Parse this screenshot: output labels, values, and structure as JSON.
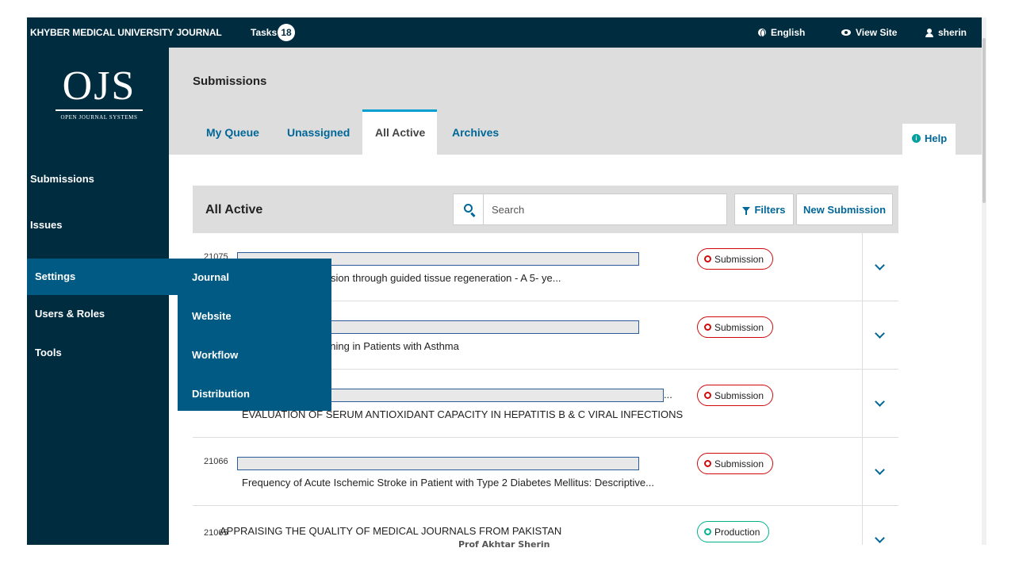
{
  "topbar": {
    "site_name": "KHYBER MEDICAL UNIVERSITY JOURNAL",
    "tasks_label": "Tasks",
    "tasks_count": "18",
    "language": "English",
    "view_site": "View Site",
    "user": "sherin"
  },
  "logo": {
    "text": "OJS",
    "subtitle": "OPEN JOURNAL SYSTEMS"
  },
  "sidebar": {
    "items": [
      {
        "label": "Submissions"
      },
      {
        "label": "Issues"
      },
      {
        "label": "Settings"
      },
      {
        "label": "Users & Roles"
      },
      {
        "label": "Tools"
      }
    ],
    "settings_flyout": [
      "Journal",
      "Website",
      "Workflow",
      "Distribution"
    ]
  },
  "header": {
    "title": "Submissions",
    "tabs": [
      "My Queue",
      "Unassigned",
      "All Active",
      "Archives"
    ],
    "active_tab": "All Active",
    "help": "Help"
  },
  "panel": {
    "title": "All Active",
    "search_placeholder": "Search",
    "filters_label": "Filters",
    "new_submission_label": "New Submission"
  },
  "submissions": [
    {
      "id": "21075",
      "title": "ent of endo-perio lesion through guided tissue regeneration - A 5- ye...",
      "status": "Submission"
    },
    {
      "id": "",
      "title": "d Cognitive Functioning in Patients with Asthma",
      "status": "Submission"
    },
    {
      "id": "",
      "title": "EVALUATION OF SERUM ANTIOXIDANT CAPACITY IN HEPATITIS B & C VIRAL INFECTIONS",
      "status": "Submission",
      "ellipsis": "..."
    },
    {
      "id": "21066",
      "title": "Frequency of Acute Ischemic Stroke in Patient with Type 2 Diabetes Mellitus: Descriptive...",
      "status": "Submission"
    },
    {
      "id": "21065",
      "title": "APPRAISING THE QUALITY OF MEDICAL JOURNALS FROM PAKISTAN",
      "status": "Production"
    }
  ],
  "footer": {
    "author": "Prof Akhtar Sherin"
  },
  "colors": {
    "nav_dark": "#002c40",
    "nav_active": "#005a84",
    "link": "#006798",
    "status_submission": "#d00a0a",
    "status_production": "#00b28d"
  }
}
